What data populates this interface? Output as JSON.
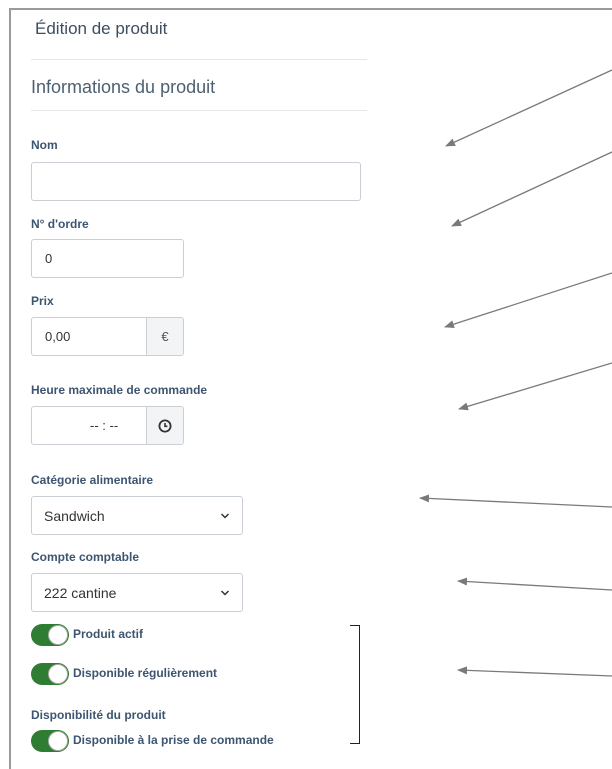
{
  "page": {
    "title": "Édition de produit",
    "section_title": "Informations du produit"
  },
  "fields": {
    "nom": {
      "label": "Nom",
      "value": ""
    },
    "ordre": {
      "label": "N° d'ordre",
      "value": "0"
    },
    "prix": {
      "label": "Prix",
      "value": "0,00",
      "currency": "€"
    },
    "heure": {
      "label": "Heure maximale de commande",
      "value": "-- : --",
      "icon": "clock-icon"
    },
    "categorie": {
      "label": "Catégorie alimentaire",
      "value": "Sandwich"
    },
    "compte": {
      "label": "Compte comptable",
      "value": "222 cantine"
    }
  },
  "toggles": {
    "actif": {
      "label": "Produit actif",
      "on": true
    },
    "regulier": {
      "label": "Disponible régulièrement",
      "on": true
    },
    "disponibilite_label": "Disponibilité du produit",
    "prise": {
      "label": "Disponible à la prise de commande",
      "on": true
    }
  },
  "colors": {
    "label": "#3d5570",
    "toggle_on": "#2e7d32",
    "annotation": "#7a7a7a"
  }
}
